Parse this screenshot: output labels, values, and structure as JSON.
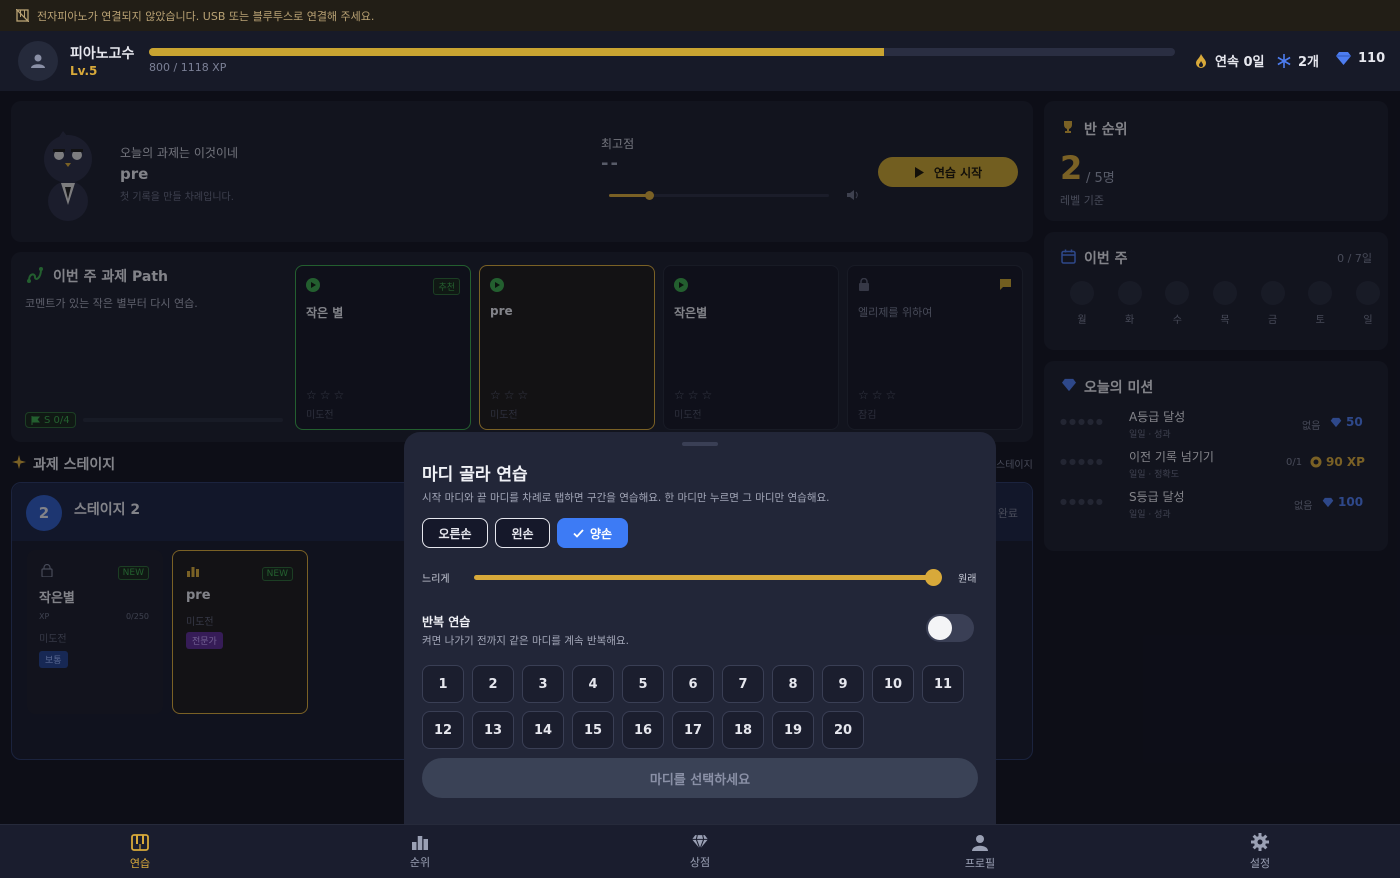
{
  "warning": {
    "text": "전자피아노가 연결되지 않았습니다. USB 또는 블루투스로 연결해 주세요."
  },
  "header": {
    "user_name": "피아노고수",
    "level": "Lv.5",
    "xp_text": "800 / 1118 XP",
    "xp_progress": 0.716,
    "streak": "연속 0일",
    "freeze": "2개",
    "gems": "110"
  },
  "today": {
    "greeting": "오늘의 과제는 이것이네",
    "song": "pre",
    "subtitle": "첫 기록을 만들 차례입니다.",
    "best_label": "최고점",
    "best_value": "--",
    "volume_level": 0.18,
    "start_button": "연습 시작"
  },
  "path": {
    "title": "이번 주 과제 Path",
    "subtitle": "코멘트가 있는 작은 별부터 다시 연습.",
    "progress_badge": "S 0/4",
    "cards": [
      {
        "title": "작은 별",
        "badge": "추천",
        "stars": "☆☆☆",
        "status": "미도전"
      },
      {
        "title": "pre",
        "badge": "",
        "stars": "☆☆☆",
        "status": "미도전"
      },
      {
        "title": "작은별",
        "badge": "",
        "stars": "☆☆☆",
        "status": "미도전"
      },
      {
        "title": "엘리제를 위하여",
        "badge": "",
        "stars": "☆☆☆",
        "status": "잠김"
      }
    ]
  },
  "stages": {
    "title": "과제 스테이지",
    "right_link": "스테이지",
    "stage_number": "2",
    "stage_name": "스테이지 2",
    "stage_status": "완료",
    "card1": {
      "badge": "NEW",
      "title": "작은별",
      "xp_label": "XP",
      "xp_value": "0/250",
      "status": "미도전",
      "tag": "보통"
    },
    "card2": {
      "badge": "NEW",
      "title": "pre",
      "status": "미도전",
      "tag": "전문가"
    }
  },
  "rank": {
    "title": "반 순위",
    "value": "2",
    "total": "/ 5명",
    "basis": "레벨 기준"
  },
  "week": {
    "title": "이번 주",
    "count": "0 / 7일",
    "days": [
      "월",
      "화",
      "수",
      "목",
      "금",
      "토",
      "일"
    ]
  },
  "missions": {
    "title": "오늘의 미션",
    "items": [
      {
        "name": "A등급 달성",
        "sub": "일일 · 성과",
        "progress": "없음",
        "reward": "50",
        "reward_type": "gem"
      },
      {
        "name": "이전 기록 넘기기",
        "sub": "일일 · 정확도",
        "progress": "0/1",
        "reward": "90 XP",
        "reward_type": "xp"
      },
      {
        "name": "S등급 달성",
        "sub": "일일 · 성과",
        "progress": "없음",
        "reward": "100",
        "reward_type": "gem"
      }
    ]
  },
  "modal": {
    "title": "마디 골라 연습",
    "description": "시작 마디와 끝 마디를 차례로 탭하면 구간을 연습해요. 한 마디만 누르면 그 마디만 연습해요.",
    "hand_right": "오른손",
    "hand_left": "왼손",
    "hand_both": "양손",
    "selected_hand": "양손",
    "speed_slow": "느리게",
    "speed_normal": "원래",
    "speed_value": 1.0,
    "repeat_title": "반복 연습",
    "repeat_desc": "켜면 나가기 전까지 같은 마디를 계속 반복해요.",
    "repeat_on": false,
    "bars": [
      "1",
      "2",
      "3",
      "4",
      "5",
      "6",
      "7",
      "8",
      "9",
      "10",
      "11",
      "12",
      "13",
      "14",
      "15",
      "16",
      "17",
      "18",
      "19",
      "20"
    ],
    "confirm_button": "마디를 선택하세요"
  },
  "nav": {
    "items": [
      "연습",
      "순위",
      "상점",
      "프로필",
      "설정"
    ],
    "active": "연습"
  },
  "colors": {
    "accent": "#d8a93a",
    "blue": "#3d7bf5",
    "green": "#3aa64b",
    "gem": "#4d7df0"
  }
}
